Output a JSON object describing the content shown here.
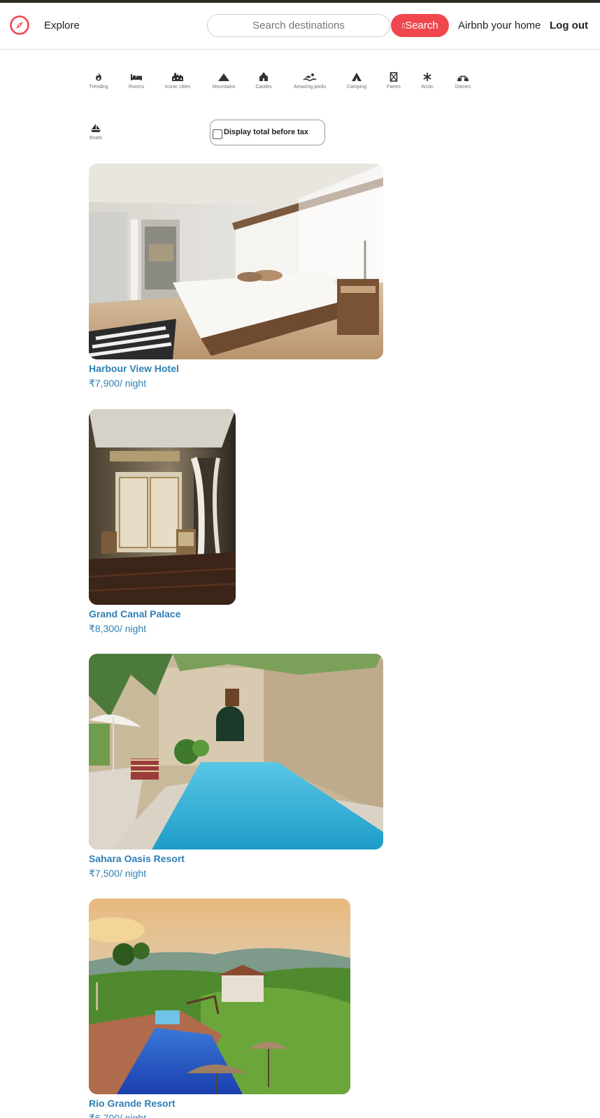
{
  "navbar": {
    "explore_label": "Explore",
    "search_placeholder": "Search destinations",
    "search_button_label": "Search",
    "host_label": "Airbnb your home",
    "logout_label": "Log out",
    "accent_color": "#f0474f"
  },
  "categories": [
    {
      "label": "Trending",
      "icon": "flame-icon"
    },
    {
      "label": "Rooms",
      "icon": "bed-icon"
    },
    {
      "label": "Iconic cities",
      "icon": "city-icon"
    },
    {
      "label": "Mountains",
      "icon": "mountain-icon"
    },
    {
      "label": "Castles",
      "icon": "castle-icon"
    },
    {
      "label": "Amazing pools",
      "icon": "swimmer-icon"
    },
    {
      "label": "Camping",
      "icon": "tent-icon"
    },
    {
      "label": "Farms",
      "icon": "barn-icon"
    },
    {
      "label": "Arctic",
      "icon": "snowflake-icon"
    },
    {
      "label": "Domes",
      "icon": "igloo-icon"
    },
    {
      "label": "Boats",
      "icon": "sailboat-icon"
    }
  ],
  "tax_toggle": {
    "label": "Display total before tax",
    "checked": false
  },
  "listings": [
    {
      "name": "Harbour View Hotel",
      "price": "₹7,900/ night",
      "photo": "bedroom-photo"
    },
    {
      "name": "Grand Canal Palace",
      "price": "₹8,300/ night",
      "photo": "palace-room-photo"
    },
    {
      "name": "Sahara Oasis Resort",
      "price": "₹7,500/ night",
      "photo": "courtyard-pool-photo"
    },
    {
      "name": "Rio Grande Resort",
      "price": "₹6,700/ night",
      "photo": "hillside-pool-photo"
    }
  ],
  "text_color": "#2f7fb6"
}
